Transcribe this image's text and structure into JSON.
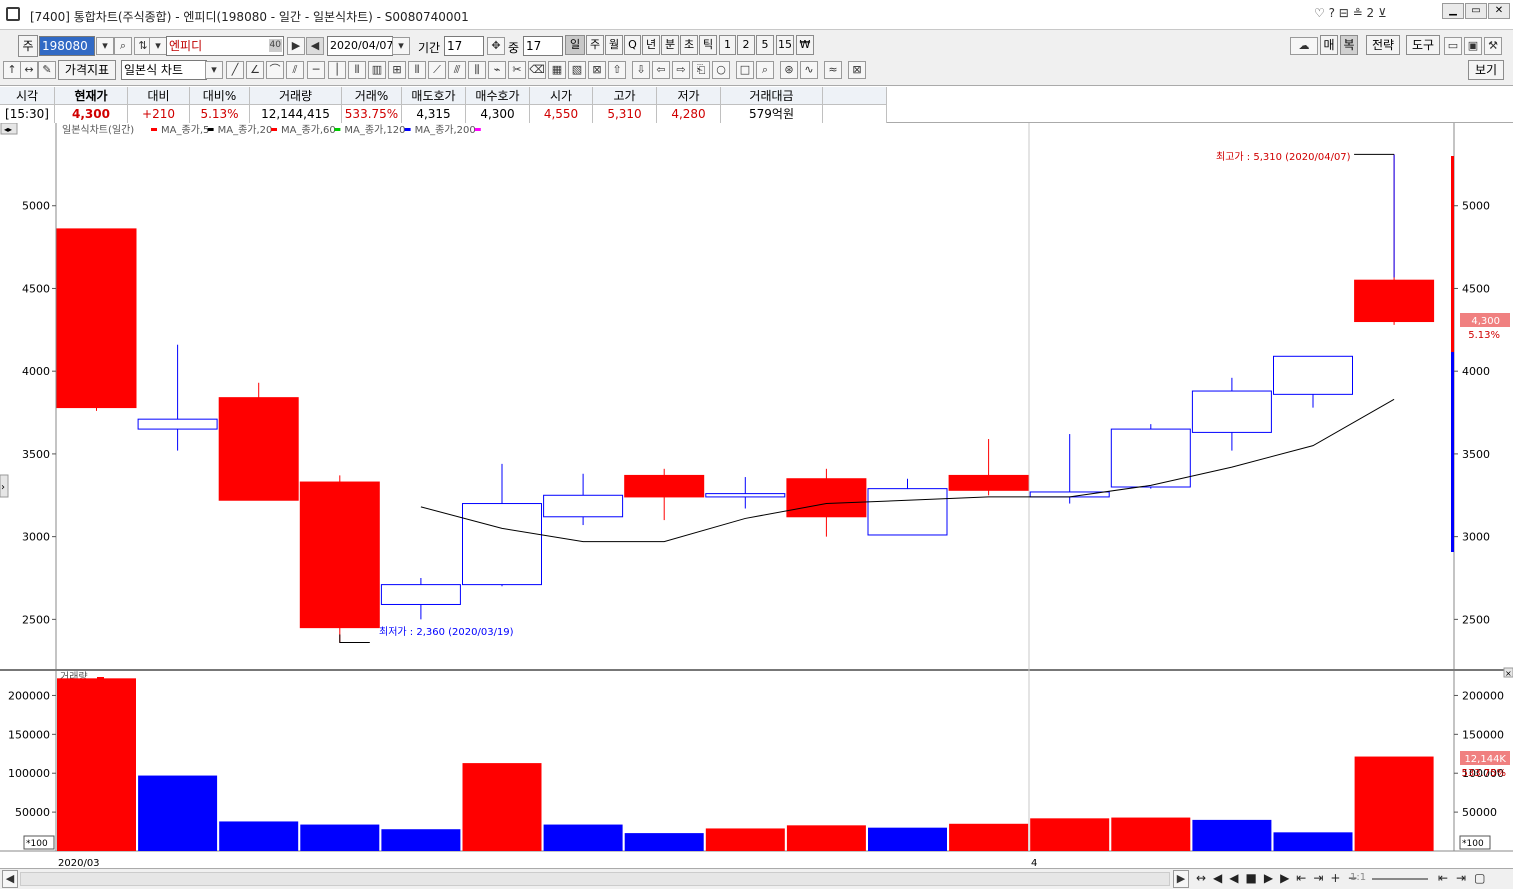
{
  "window": {
    "title": "[7400] 통합차트(주식종합) - 엔피디(198080 - 일간 - 일본식차트) - S0080740001",
    "right_icons": "♡ ? ⊟ ≗ 2 ⊻"
  },
  "toolbar1": {
    "mode": "주",
    "code": "198080",
    "name": "엔피디",
    "name_badge": "40",
    "date": "2020/04/07",
    "period_label": "기간",
    "period_value": "17",
    "count_label": "중",
    "count_value": "17",
    "intervals": [
      "일",
      "주",
      "월",
      "Q",
      "년",
      "분",
      "초",
      "틱",
      "1",
      "2",
      "5",
      "15",
      "₩"
    ],
    "right_buttons": [
      "매",
      "복",
      "전략",
      "도구"
    ]
  },
  "toolbar2": {
    "indicator_btn": "가격지표",
    "chart_type": "일본식 차트",
    "view_btn": "보기"
  },
  "quote": {
    "headers": [
      "시각",
      "현재가",
      "대비",
      "대비%",
      "거래량",
      "거래%",
      "매도호가",
      "매수호가",
      "시가",
      "고가",
      "저가",
      "거래대금"
    ],
    "values": [
      "[15:30]",
      "4,300",
      "+210",
      "5.13%",
      "12,144,415",
      "533.75%",
      "4,315",
      "4,300",
      "4,550",
      "5,310",
      "4,280",
      "579억원"
    ]
  },
  "chart_data": [
    {
      "type": "candlestick",
      "legend": [
        "일본식차트(일간)",
        "MA_종가,5",
        "MA_종가,20",
        "MA_종가,60",
        "MA_종가,120",
        "MA_종가,200"
      ],
      "legend_colors": [
        "#ff0000",
        "#000000",
        "#ff0000",
        "#00cc00",
        "#0000ff",
        "#ff00ff"
      ],
      "yticks": [
        2500,
        3000,
        3500,
        4000,
        4500,
        5000
      ],
      "ylim": [
        2200,
        5500
      ],
      "candles": [
        {
          "o": 3780,
          "h": 4860,
          "l": 3760,
          "c": 4860
        },
        {
          "o": 3710,
          "h": 4160,
          "l": 3520,
          "c": 3650
        },
        {
          "o": 3220,
          "h": 3930,
          "l": 3220,
          "c": 3840
        },
        {
          "o": 2450,
          "h": 3370,
          "l": 2360,
          "c": 3330
        },
        {
          "o": 2710,
          "h": 2750,
          "l": 2500,
          "c": 2590
        },
        {
          "o": 3200,
          "h": 3440,
          "l": 2700,
          "c": 2710
        },
        {
          "o": 3250,
          "h": 3380,
          "l": 3070,
          "c": 3120
        },
        {
          "o": 3240,
          "h": 3410,
          "l": 3100,
          "c": 3370
        },
        {
          "o": 3260,
          "h": 3360,
          "l": 3170,
          "c": 3240
        },
        {
          "o": 3120,
          "h": 3410,
          "l": 3000,
          "c": 3350
        },
        {
          "o": 3290,
          "h": 3350,
          "l": 3010,
          "c": 3010
        },
        {
          "o": 3280,
          "h": 3590,
          "l": 3250,
          "c": 3370
        },
        {
          "o": 3270,
          "h": 3620,
          "l": 3200,
          "c": 3240
        },
        {
          "o": 3650,
          "h": 3680,
          "l": 3290,
          "c": 3300
        },
        {
          "o": 3880,
          "h": 3960,
          "l": 3520,
          "c": 3630
        },
        {
          "o": 4090,
          "h": 4090,
          "l": 3780,
          "c": 3860
        },
        {
          "o": 4300,
          "h": 5310,
          "l": 4280,
          "c": 4550
        }
      ],
      "ma5": [
        null,
        null,
        null,
        null,
        3180,
        3050,
        2970,
        2970,
        3110,
        3200,
        3220,
        3240,
        3240,
        3310,
        3420,
        3550,
        3830
      ],
      "high_label": "최고가 : 5,310 (2020/04/07)",
      "low_label": "최저가 : 2,360 (2020/03/19)",
      "last_price_tag": "4,300",
      "last_pct_tag": "5.13%"
    },
    {
      "type": "bar",
      "title": "거래량",
      "unit_tag": "*100",
      "yticks": [
        50000,
        100000,
        150000,
        200000
      ],
      "ylim": [
        0,
        225000
      ],
      "values": [
        222000,
        97000,
        38000,
        34000,
        28000,
        113000,
        34000,
        23000,
        29000,
        33000,
        30000,
        35000,
        42000,
        43000,
        40000,
        24000,
        121444
      ],
      "colors": [
        "r",
        "b",
        "b",
        "b",
        "b",
        "r",
        "b",
        "b",
        "r",
        "r",
        "b",
        "r",
        "r",
        "r",
        "b",
        "b",
        "r"
      ],
      "last_tag": "12,144K",
      "last_pct": "533.75%"
    }
  ],
  "xaxis": {
    "labels": [
      "2020/03",
      "4"
    ]
  }
}
